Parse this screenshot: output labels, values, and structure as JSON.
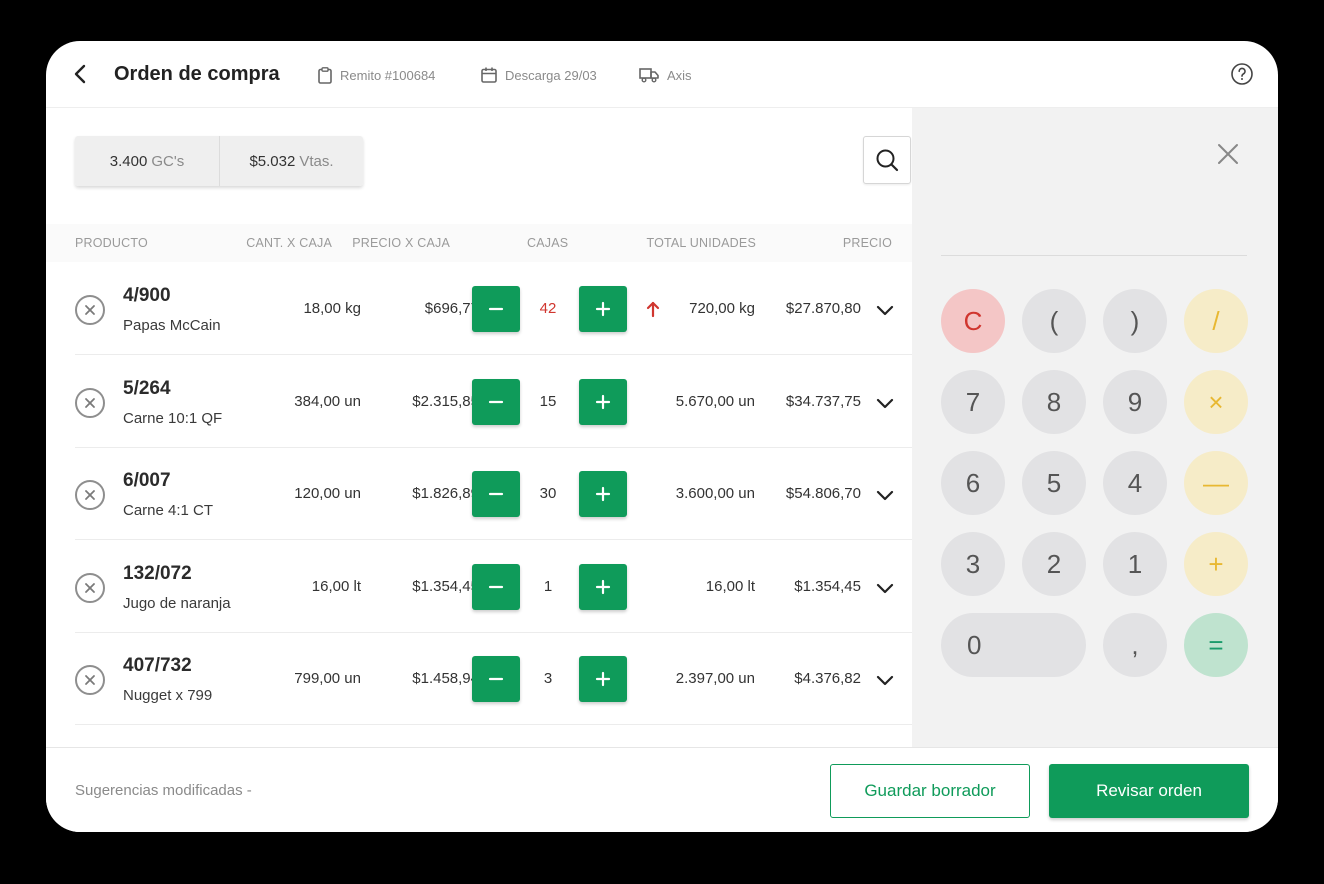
{
  "header": {
    "title": "Orden de compra",
    "remito": "Remito #100684",
    "descarga": "Descarga 29/03",
    "transport": "Axis"
  },
  "summary": {
    "gcs_value": "3.400",
    "gcs_unit": "GC's",
    "sales_value": "$5.032",
    "sales_unit": "Vtas."
  },
  "table": {
    "columns": [
      "PRODUCTO",
      "CANT. X CAJA",
      "PRECIO X CAJA",
      "CAJAS",
      "TOTAL UNIDADES",
      "PRECIO"
    ],
    "rows": [
      {
        "code": "4/900",
        "name": "Papas McCain",
        "cant": "18,00 kg",
        "precio_caja": "$696,77",
        "cajas": "42",
        "total": "720,00 kg",
        "precio": "$27.870,80",
        "flag_up": true
      },
      {
        "code": "5/264",
        "name": "Carne 10:1 QF",
        "cant": "384,00 un",
        "precio_caja": "$2.315,85",
        "cajas": "15",
        "total": "5.670,00 un",
        "precio": "$34.737,75",
        "flag_up": false
      },
      {
        "code": "6/007",
        "name": "Carne 4:1 CT",
        "cant": "120,00 un",
        "precio_caja": "$1.826,89",
        "cajas": "30",
        "total": "3.600,00 un",
        "precio": "$54.806,70",
        "flag_up": false
      },
      {
        "code": "132/072",
        "name": "Jugo de naranja",
        "cant": "16,00 lt",
        "precio_caja": "$1.354,45",
        "cajas": "1",
        "total": "16,00 lt",
        "precio": "$1.354,45",
        "flag_up": false
      },
      {
        "code": "407/732",
        "name": "Nugget x 799",
        "cant": "799,00 un",
        "precio_caja": "$1.458,94",
        "cajas": "3",
        "total": "2.397,00 un",
        "precio": "$4.376,82",
        "flag_up": false
      }
    ]
  },
  "calculator": {
    "keys": [
      "C",
      "(",
      ")",
      "/",
      "7",
      "8",
      "9",
      "×",
      "6",
      "5",
      "4",
      "—",
      "3",
      "2",
      "1",
      "+",
      "0",
      ",",
      "="
    ]
  },
  "footer": {
    "note": "Sugerencias modificadas -",
    "save_draft": "Guardar borrador",
    "review": "Revisar orden"
  },
  "colors": {
    "accent": "#0f9b5a",
    "warning": "#d0362f",
    "clear_key": "#f4c6c6",
    "operator_key": "#f6ecc8",
    "equals_key": "#bfe3cf"
  }
}
